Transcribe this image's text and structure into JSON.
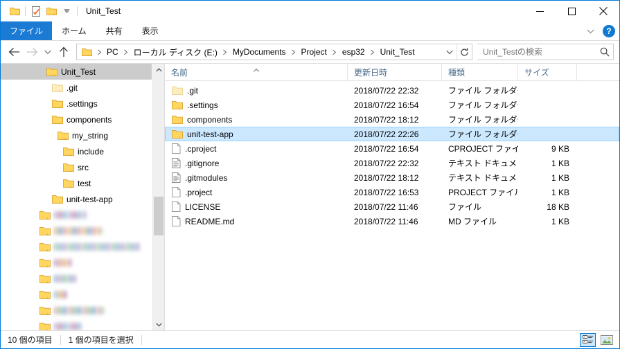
{
  "window": {
    "title": "Unit_Test",
    "quick_access": [
      {
        "name": "folder-icon",
        "label": "folder"
      },
      {
        "name": "properties-icon",
        "label": "properties"
      },
      {
        "name": "new-folder-icon",
        "label": "new folder"
      },
      {
        "name": "chevron-down-icon",
        "label": "customize"
      }
    ],
    "controls": {
      "minimize": "minimize",
      "maximize": "maximize",
      "close": "close"
    }
  },
  "ribbon": {
    "tabs": [
      {
        "label": "ファイル",
        "active": true
      },
      {
        "label": "ホーム",
        "active": false
      },
      {
        "label": "共有",
        "active": false
      },
      {
        "label": "表示",
        "active": false
      }
    ],
    "collapse": "ribbon-collapse",
    "help": "?"
  },
  "address": {
    "back": "back",
    "forward": "forward",
    "recent": "recent-locations",
    "up": "up",
    "crumbs": [
      "PC",
      "ローカル ディスク (E:)",
      "MyDocuments",
      "Project",
      "esp32",
      "Unit_Test"
    ],
    "dropdown": "previous-locations",
    "refresh": "refresh"
  },
  "search": {
    "placeholder": "Unit_Testの検索",
    "value": ""
  },
  "navpane": {
    "items": [
      {
        "label": "Unit_Test",
        "indent": 66,
        "selected": true,
        "faded": false,
        "blur": false
      },
      {
        "label": ".git",
        "indent": 74,
        "selected": false,
        "faded": true,
        "blur": false
      },
      {
        "label": ".settings",
        "indent": 74,
        "selected": false,
        "faded": false,
        "blur": false
      },
      {
        "label": "components",
        "indent": 74,
        "selected": false,
        "faded": false,
        "blur": false
      },
      {
        "label": "my_string",
        "indent": 82,
        "selected": false,
        "faded": false,
        "blur": false
      },
      {
        "label": "include",
        "indent": 90,
        "selected": false,
        "faded": false,
        "blur": false
      },
      {
        "label": "src",
        "indent": 90,
        "selected": false,
        "faded": false,
        "blur": false
      },
      {
        "label": "test",
        "indent": 90,
        "selected": false,
        "faded": false,
        "blur": false
      },
      {
        "label": "unit-test-app",
        "indent": 74,
        "selected": false,
        "faded": false,
        "blur": false
      },
      {
        "label": "",
        "indent": 56,
        "selected": false,
        "faded": false,
        "blur": true,
        "blurwidth": 48
      },
      {
        "label": "",
        "indent": 56,
        "selected": false,
        "faded": false,
        "blur": true,
        "blurwidth": 70
      },
      {
        "label": "",
        "indent": 56,
        "selected": false,
        "faded": false,
        "blur": true,
        "blurwidth": 125
      },
      {
        "label": "",
        "indent": 56,
        "selected": false,
        "faded": false,
        "blur": true,
        "blurwidth": 26
      },
      {
        "label": "",
        "indent": 56,
        "selected": false,
        "faded": false,
        "blur": true,
        "blurwidth": 32
      },
      {
        "label": "",
        "indent": 56,
        "selected": false,
        "faded": false,
        "blur": true,
        "blurwidth": 20
      },
      {
        "label": "",
        "indent": 56,
        "selected": false,
        "faded": false,
        "blur": true,
        "blurwidth": 72
      },
      {
        "label": "",
        "indent": 56,
        "selected": false,
        "faded": false,
        "blur": true,
        "blurwidth": 40
      }
    ]
  },
  "filelist": {
    "columns": [
      {
        "key": "name",
        "label": "名前",
        "sorted": true
      },
      {
        "key": "date",
        "label": "更新日時",
        "sorted": false
      },
      {
        "key": "type",
        "label": "種類",
        "sorted": false
      },
      {
        "key": "size",
        "label": "サイズ",
        "sorted": false
      }
    ],
    "rows": [
      {
        "name": ".git",
        "date": "2018/07/22 22:32",
        "type": "ファイル フォルダー",
        "size": "",
        "icon": "folder-icon",
        "faded": true,
        "selected": false
      },
      {
        "name": ".settings",
        "date": "2018/07/22 16:54",
        "type": "ファイル フォルダー",
        "size": "",
        "icon": "folder-icon",
        "faded": false,
        "selected": false
      },
      {
        "name": "components",
        "date": "2018/07/22 18:12",
        "type": "ファイル フォルダー",
        "size": "",
        "icon": "folder-icon",
        "faded": false,
        "selected": false
      },
      {
        "name": "unit-test-app",
        "date": "2018/07/22 22:26",
        "type": "ファイル フォルダー",
        "size": "",
        "icon": "folder-icon",
        "faded": false,
        "selected": true
      },
      {
        "name": ".cproject",
        "date": "2018/07/22 16:54",
        "type": "CPROJECT ファイル",
        "size": "9 KB",
        "icon": "file-icon",
        "faded": false,
        "selected": false
      },
      {
        "name": ".gitignore",
        "date": "2018/07/22 22:32",
        "type": "テキスト ドキュメント",
        "size": "1 KB",
        "icon": "text-file-icon",
        "faded": false,
        "selected": false
      },
      {
        "name": ".gitmodules",
        "date": "2018/07/22 18:12",
        "type": "テキスト ドキュメント",
        "size": "1 KB",
        "icon": "text-file-icon",
        "faded": false,
        "selected": false
      },
      {
        "name": ".project",
        "date": "2018/07/22 16:53",
        "type": "PROJECT ファイル",
        "size": "1 KB",
        "icon": "file-icon",
        "faded": false,
        "selected": false
      },
      {
        "name": "LICENSE",
        "date": "2018/07/22 11:46",
        "type": "ファイル",
        "size": "18 KB",
        "icon": "file-icon",
        "faded": false,
        "selected": false
      },
      {
        "name": "README.md",
        "date": "2018/07/22 11:46",
        "type": "MD ファイル",
        "size": "1 KB",
        "icon": "file-icon",
        "faded": false,
        "selected": false
      }
    ]
  },
  "statusbar": {
    "item_count": "10 個の項目",
    "selection": "1 個の項目を選択",
    "views": [
      {
        "name": "details-view-button",
        "active": true
      },
      {
        "name": "large-icons-view-button",
        "active": false
      }
    ]
  },
  "colors": {
    "accent": "#1b7ad4",
    "selection_fill": "#cce8ff",
    "selection_border": "#99d1ff",
    "nav_selection": "#cccccc",
    "folder": "#ffd75e",
    "header_text": "#4a6c8c"
  }
}
